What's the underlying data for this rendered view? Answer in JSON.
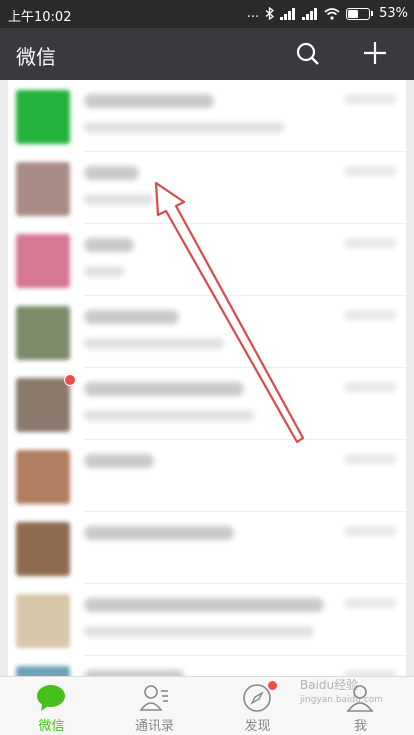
{
  "status_bar": {
    "time": "上午10:02",
    "signal_dots": "...",
    "battery": "53%",
    "battery_level": 0.53
  },
  "header": {
    "title": "微信"
  },
  "chat_rows": [
    {
      "avatar_color": "#23b33c",
      "name_w": 130,
      "msg_w": 200,
      "badge": false
    },
    {
      "avatar_color": "#a98c85",
      "name_w": 55,
      "msg_w": 70,
      "badge": false
    },
    {
      "avatar_color": "#d67893",
      "name_w": 50,
      "msg_w": 40,
      "badge": false
    },
    {
      "avatar_color": "#7d8b6a",
      "name_w": 95,
      "msg_w": 140,
      "badge": false
    },
    {
      "avatar_color": "#8b7a6c",
      "name_w": 160,
      "msg_w": 170,
      "badge": true
    },
    {
      "avatar_color": "#b17d5f",
      "name_w": 70,
      "msg_w": 0,
      "badge": false
    },
    {
      "avatar_color": "#8e6b4e",
      "name_w": 150,
      "msg_w": 0,
      "badge": false
    },
    {
      "avatar_color": "#d7c6a8",
      "name_w": 240,
      "msg_w": 230,
      "badge": false
    },
    {
      "avatar_color": "#6fa3b8",
      "name_w": 100,
      "msg_w": 80,
      "badge": false
    }
  ],
  "tabs": [
    {
      "label": "微信",
      "active": true,
      "icon": "chat-bubble-icon"
    },
    {
      "label": "通讯录",
      "active": false,
      "icon": "contacts-icon"
    },
    {
      "label": "发现",
      "active": false,
      "icon": "compass-icon",
      "badge": true
    },
    {
      "label": "我",
      "active": false,
      "icon": "person-icon"
    }
  ],
  "watermark": {
    "text": "Baidu经验",
    "sub": "jingyan.baidu.com"
  },
  "colors": {
    "wechat_green": "#45c01a",
    "header_bg": "#393a3f",
    "arrow_red": "#d94a4a"
  }
}
